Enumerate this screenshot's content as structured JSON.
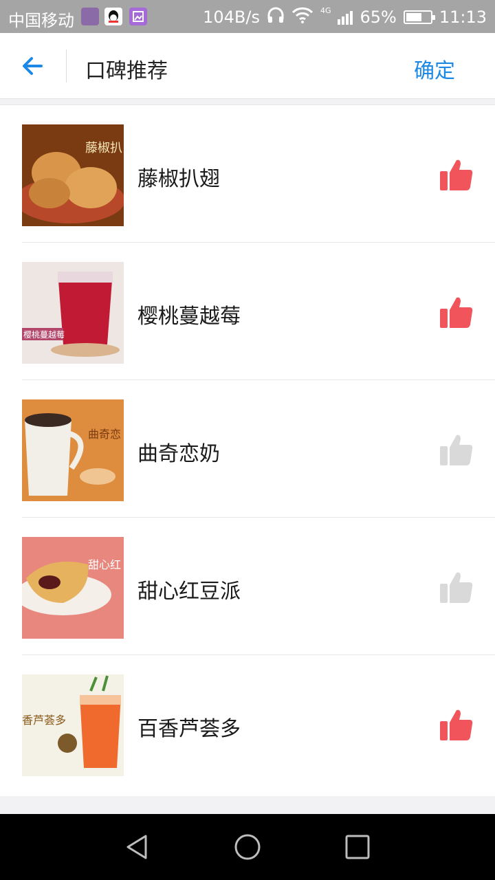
{
  "status": {
    "carrier": "中国移动",
    "speed": "104B/s",
    "network": "4G",
    "battery": "65%",
    "battery_level": 0.65,
    "time": "11:13"
  },
  "header": {
    "title": "口碑推荐",
    "confirm": "确定",
    "back_icon": "arrow-left-icon",
    "accent": "#1e88e5"
  },
  "items": [
    {
      "name": "藤椒扒翅",
      "liked": true,
      "thumb_text": "藤椒扒"
    },
    {
      "name": "樱桃蔓越莓",
      "liked": true,
      "thumb_text": "樱桃蔓越莓"
    },
    {
      "name": "曲奇恋奶",
      "liked": false,
      "thumb_text": "曲奇恋"
    },
    {
      "name": "甜心红豆派",
      "liked": false,
      "thumb_text": "甜心红"
    },
    {
      "name": "百香芦荟多",
      "liked": true,
      "thumb_text": "香芦荟多"
    }
  ],
  "colors": {
    "liked": "#f2545b",
    "unliked": "#d9d9d9"
  }
}
